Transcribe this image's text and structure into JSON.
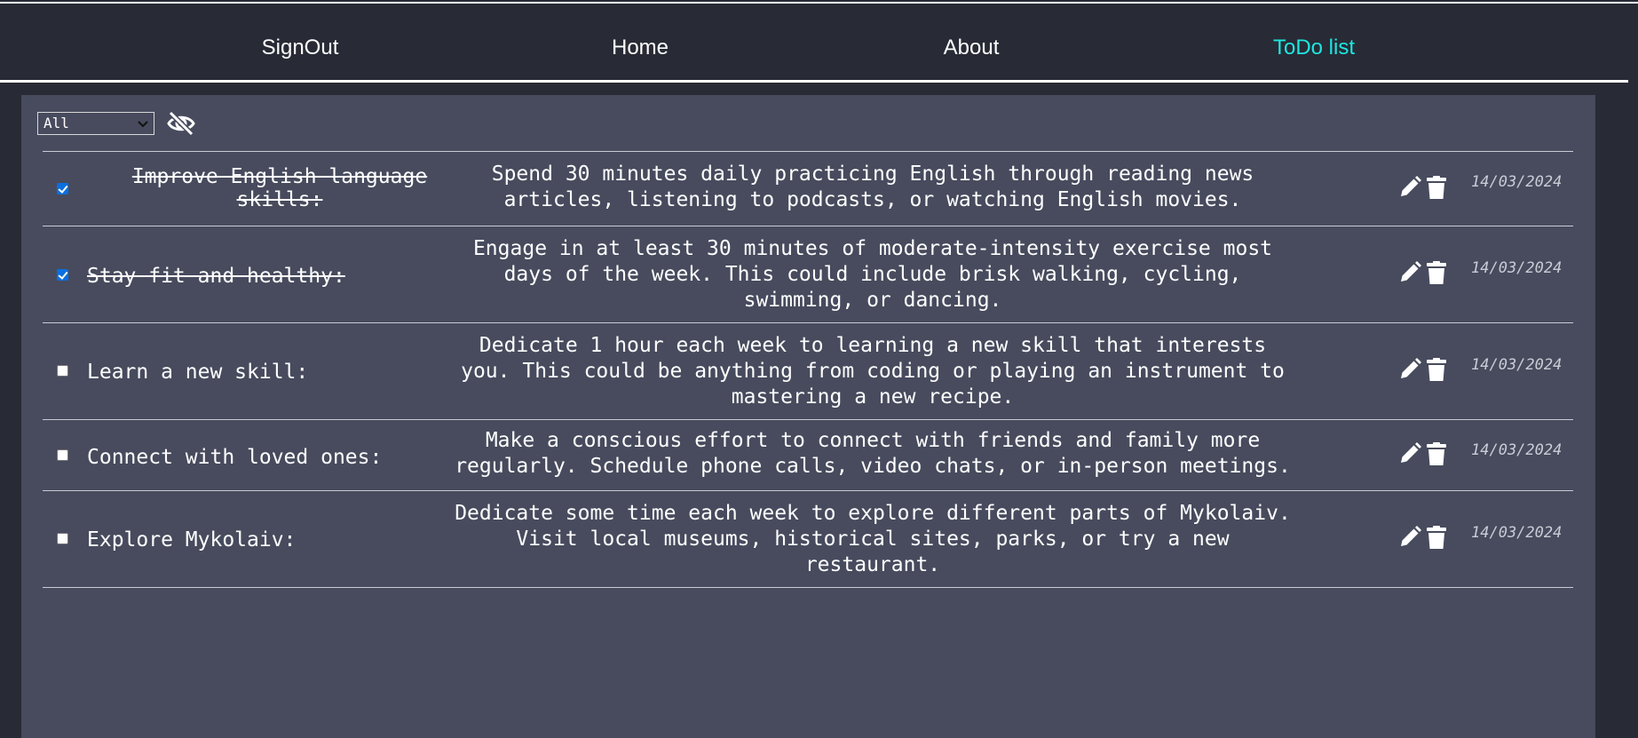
{
  "nav": {
    "signout": "SignOut",
    "home": "Home",
    "about": "About",
    "todo": "ToDo list"
  },
  "filter": {
    "selected": "All"
  },
  "colors": {
    "background": "#282b35",
    "panel": "#474b5d",
    "accent": "#1de6e0",
    "checkbox_checked": "#0b6fe0"
  },
  "icons": {
    "visibility_toggle": "eye-slash-icon",
    "edit": "pencil-icon",
    "delete": "trash-icon",
    "select_arrow": "chevron-down-icon"
  },
  "todos": [
    {
      "checked": true,
      "title_lines": [
        "Improve English language",
        "skills:"
      ],
      "description_lines": [
        "Spend 30 minutes daily practicing English through reading news",
        "articles, listening to podcasts, or watching English movies."
      ],
      "date": "14/03/2024"
    },
    {
      "checked": true,
      "title_lines": [
        "Stay fit and healthy:"
      ],
      "description_lines": [
        "Engage in at least 30 minutes of moderate-intensity exercise most",
        "days of the week. This could include brisk walking, cycling,",
        "swimming, or dancing."
      ],
      "date": "14/03/2024"
    },
    {
      "checked": false,
      "title_lines": [
        "Learn a new skill:"
      ],
      "description_lines": [
        "Dedicate 1 hour each week to learning a new skill that interests",
        "you. This could be anything from coding or playing an instrument to",
        "mastering a new recipe."
      ],
      "date": "14/03/2024"
    },
    {
      "checked": false,
      "title_lines": [
        "Connect with loved ones:"
      ],
      "description_lines": [
        "Make a conscious effort to connect with friends and family more",
        "regularly. Schedule phone calls, video chats, or in-person meetings."
      ],
      "date": "14/03/2024"
    },
    {
      "checked": false,
      "title_lines": [
        "Explore Mykolaiv:"
      ],
      "description_lines": [
        "Dedicate some time each week to explore different parts of Mykolaiv.",
        "Visit local museums, historical sites, parks, or try a new",
        "restaurant."
      ],
      "date": "14/03/2024"
    }
  ]
}
